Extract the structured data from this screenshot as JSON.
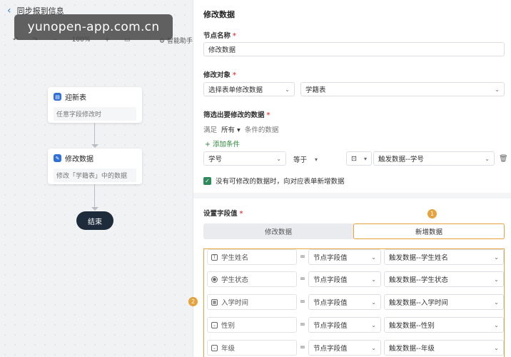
{
  "canvas": {
    "title": "同步报到信息",
    "zoom": "100%",
    "ai_helper": "智能助手",
    "watermark": "yunopen-app.com.cn",
    "nodes": [
      {
        "title": "迎新表",
        "subtitle": "任意字段修改时"
      },
      {
        "title": "修改数据",
        "subtitle": "修改「学籍表」中的数据"
      }
    ],
    "end_label": "结束"
  },
  "panel": {
    "title": "修改数据",
    "node_name_label": "节点名称",
    "node_name_value": "修改数据",
    "target_label": "修改对象",
    "target_mode": "选择表单修改数据",
    "target_table": "学籍表",
    "filter_label": "筛选出要修改的数据",
    "filter_prefix": "满足",
    "filter_scope": "所有",
    "filter_suffix": "条件的数据",
    "add_condition": "+ 添加条件",
    "condition": {
      "field": "学号",
      "operator": "等于",
      "value": "触发数据--学号"
    },
    "checkbox_label": "没有可修改的数据时，向对应表单新增数据",
    "set_label": "设置字段值",
    "badge1": "1",
    "badge2": "2",
    "tabs": [
      "修改数据",
      "新增数据"
    ],
    "field_rows": [
      {
        "icon": "text-field-icon",
        "name": "学生姓名",
        "type": "节点字段值",
        "value": "触发数据--学生姓名"
      },
      {
        "icon": "radio-field-icon",
        "name": "学生状态",
        "type": "节点字段值",
        "value": "触发数据--学生状态"
      },
      {
        "icon": "date-field-icon",
        "name": "入学时间",
        "type": "节点字段值",
        "value": "触发数据--入学时间"
      },
      {
        "icon": "select-field-icon",
        "name": "性别",
        "type": "节点字段值",
        "value": "触发数据--性别"
      },
      {
        "icon": "select-field-icon",
        "name": "年级",
        "type": "节点字段值",
        "value": "触发数据--年级"
      }
    ],
    "eq_sign": "="
  }
}
